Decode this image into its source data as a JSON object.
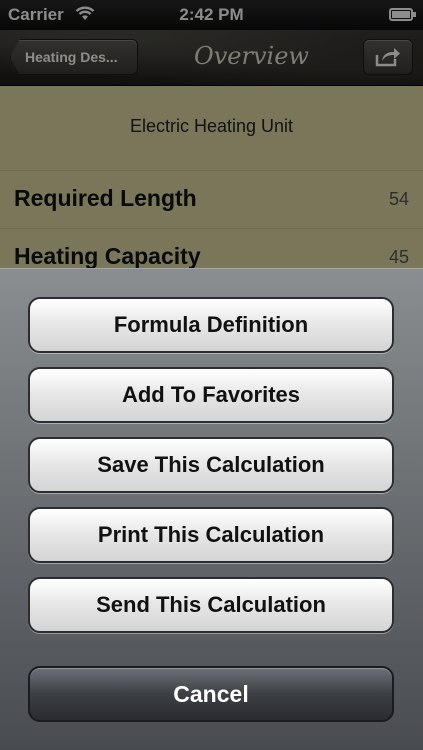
{
  "status_bar": {
    "carrier": "Carrier",
    "time": "2:42 PM",
    "wifi_icon": "wifi-icon",
    "battery_icon": "battery-icon"
  },
  "nav_bar": {
    "back_label": "Heating Des...",
    "title": "Overview",
    "share_icon": "share-icon"
  },
  "content": {
    "subtitle": "Electric Heating Unit",
    "rows": [
      {
        "label": "Required Length",
        "value": "54"
      },
      {
        "label": "Heating Capacity",
        "value": "45"
      }
    ]
  },
  "action_sheet": {
    "buttons": [
      "Formula Definition",
      "Add To Favorites",
      "Save This Calculation",
      "Print This Calculation",
      "Send This Calculation"
    ],
    "cancel": "Cancel"
  },
  "colors": {
    "content_bg": "#ddd8a3",
    "sheet_bg": "#6e7278"
  }
}
